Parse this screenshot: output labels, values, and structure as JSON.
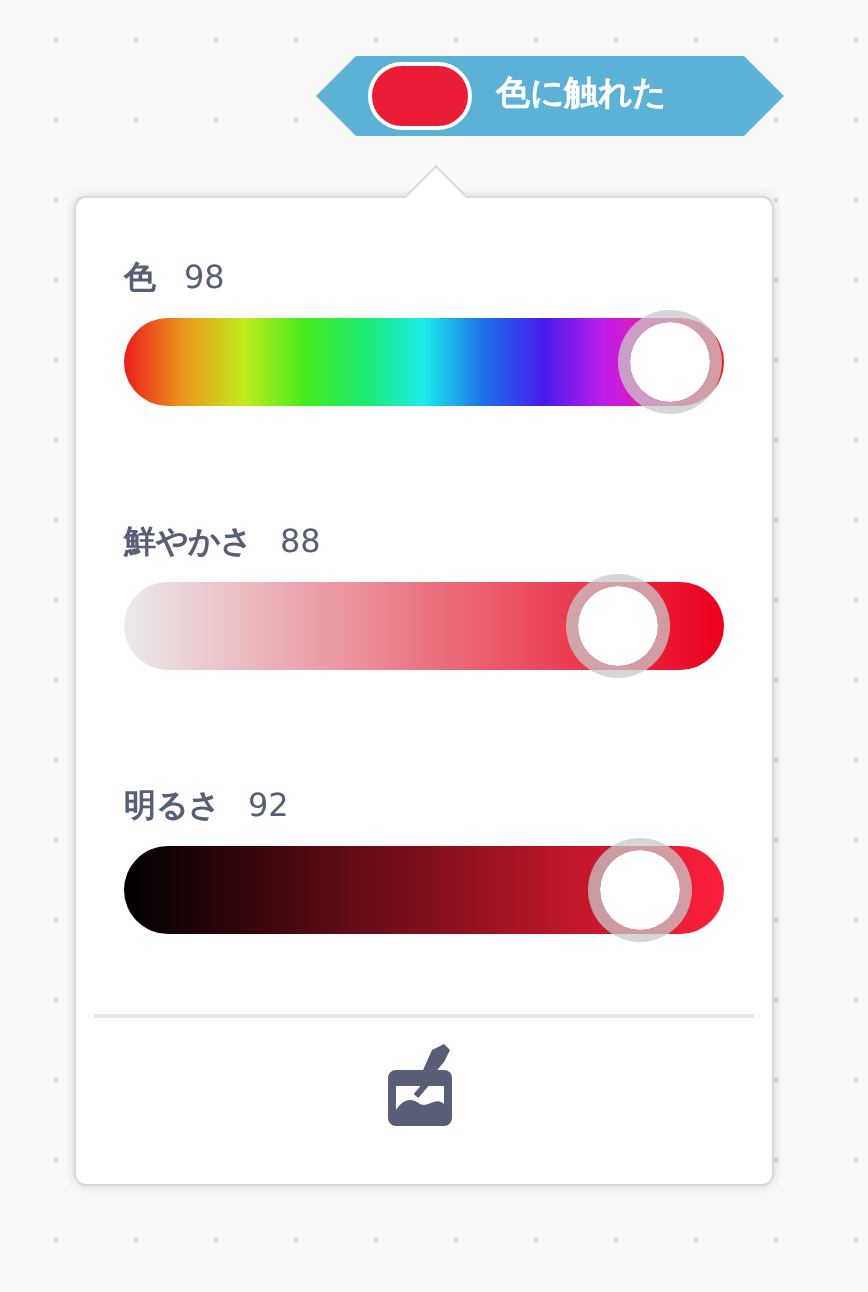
{
  "block": {
    "label": "色に触れた"
  },
  "sliders": [
    {
      "label": "色",
      "value": "98",
      "level": 0.98
    },
    {
      "label": "鮮やかさ",
      "value": "88",
      "level": 0.88
    },
    {
      "label": "明るさ",
      "value": "92",
      "level": 0.92
    }
  ]
}
